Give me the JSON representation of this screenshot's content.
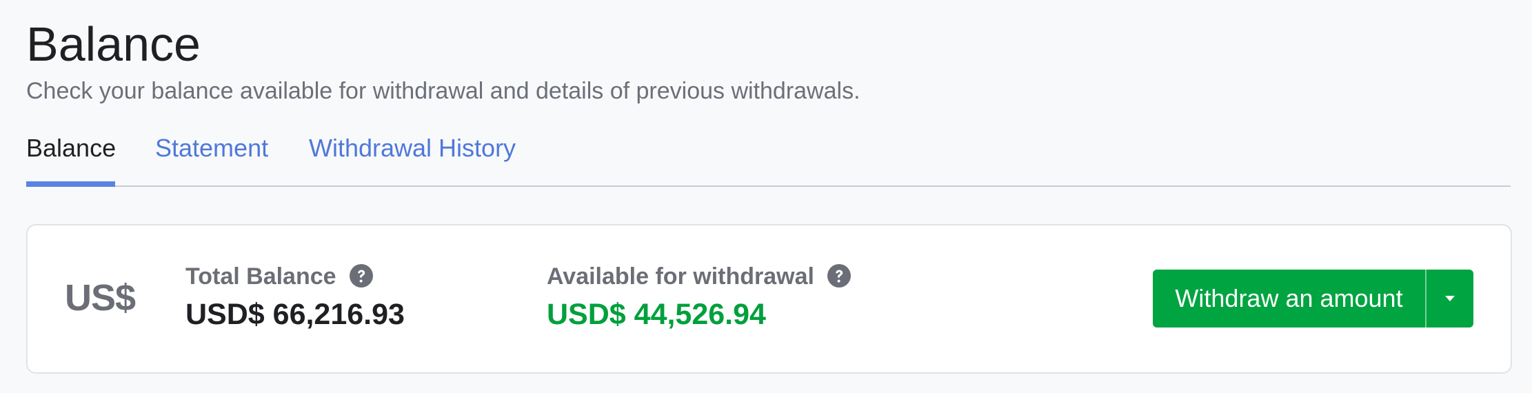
{
  "header": {
    "title": "Balance",
    "subtitle": "Check your balance available for withdrawal and details of previous withdrawals."
  },
  "tabs": [
    {
      "label": "Balance",
      "active": true
    },
    {
      "label": "Statement",
      "active": false
    },
    {
      "label": "Withdrawal History",
      "active": false
    }
  ],
  "balance_card": {
    "currency_label": "US$",
    "total_balance": {
      "label": "Total Balance",
      "value": "USD$ 66,216.93",
      "help_icon": "question-circle-icon"
    },
    "available": {
      "label": "Available for withdrawal",
      "value": "USD$ 44,526.94",
      "help_icon": "question-circle-icon"
    },
    "withdraw_button": {
      "label": "Withdraw an amount",
      "dropdown_icon": "caret-down-icon"
    }
  },
  "colors": {
    "accent_blue": "#4f78d9",
    "tab_indicator": "#5a84e2",
    "success_green": "#00a441",
    "available_amount_green": "#00a03c",
    "muted_text": "#6b6e76",
    "page_background": "#f8f9fb"
  }
}
